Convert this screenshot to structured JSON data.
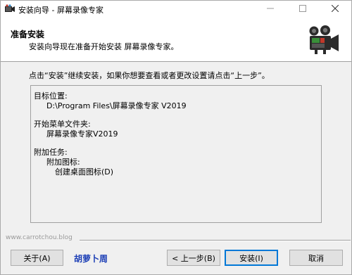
{
  "window": {
    "title": "安装向导 - 屏幕录像专家"
  },
  "header": {
    "title": "准备安装",
    "subtitle": "安装向导现在准备开始安装 屏幕录像专家。"
  },
  "instruction": "点击“安装”继续安装，如果你想要查看或者更改设置请点击“上一步”。",
  "memo": {
    "dest_label": "目标位置:",
    "dest_value": "D:\\Program Files\\屏幕录像专家 V2019",
    "startmenu_label": "开始菜单文件夹:",
    "startmenu_value": "屏幕录像专家V2019",
    "tasks_label": "附加任务:",
    "tasks_group": "附加图标:",
    "tasks_item": "创建桌面图标(D)"
  },
  "footer": {
    "watermark": "www.carrotchou.blog",
    "about_label": "关于(A)",
    "brand_link": "胡萝卜周",
    "back_label": "< 上一步(B)",
    "install_label": "安装(I)",
    "cancel_label": "取消"
  },
  "colors": {
    "link": "#1a3db5",
    "default_button_border": "#0078d7"
  }
}
